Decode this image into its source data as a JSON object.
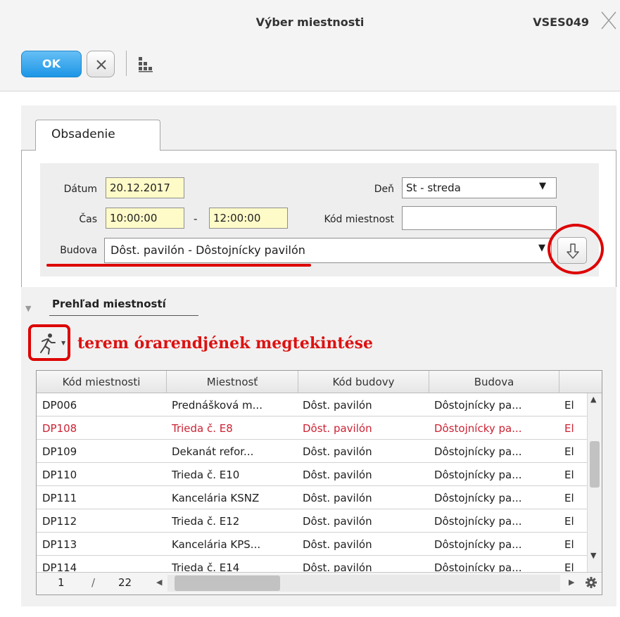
{
  "window": {
    "title": "Výber miestnosti",
    "code": "VSES049"
  },
  "toolbar": {
    "ok_label": "OK",
    "cancel_icon": "close-icon",
    "tree_icon": "hierarchy-icon"
  },
  "tab": {
    "label": "Obsadenie"
  },
  "form": {
    "datum_label": "Dátum",
    "datum_value": "20.12.2017",
    "den_label": "Deň",
    "den_value": "St - streda",
    "cas_label": "Čas",
    "cas_from": "10:00:00",
    "cas_dash": "-",
    "cas_to": "12:00:00",
    "kod_label": "Kód miestnost",
    "kod_value": "",
    "budova_label": "Budova",
    "budova_value": "Dôst. pavilón - Dôstojnícky pavilón"
  },
  "section": {
    "title": "Prehľad miestností"
  },
  "annotation": {
    "text": "terem órarendjének megtekintése",
    "color": "#dd1111"
  },
  "grid": {
    "columns": [
      "Kód miestnosti",
      "Miestnosť",
      "Kód budovy",
      "Budova"
    ],
    "rows": [
      {
        "kod": "DP006",
        "miestnost": "Prednášková m...",
        "kod_budovy": "Dôst. pavilón",
        "budova": "Dôstojnícky pa...",
        "extra": "El",
        "highlight": false
      },
      {
        "kod": "DP108",
        "miestnost": "Trieda č. E8",
        "kod_budovy": "Dôst. pavilón",
        "budova": "Dôstojnícky pa...",
        "extra": "El",
        "highlight": true
      },
      {
        "kod": "DP109",
        "miestnost": "Dekanát refor...",
        "kod_budovy": "Dôst. pavilón",
        "budova": "Dôstojnícky pa...",
        "extra": "El",
        "highlight": false
      },
      {
        "kod": "DP110",
        "miestnost": "Trieda č. E10",
        "kod_budovy": "Dôst. pavilón",
        "budova": "Dôstojnícky pa...",
        "extra": "El",
        "highlight": false
      },
      {
        "kod": "DP111",
        "miestnost": "Kancelária KSNZ",
        "kod_budovy": "Dôst. pavilón",
        "budova": "Dôstojnícky pa...",
        "extra": "El",
        "highlight": false
      },
      {
        "kod": "DP112",
        "miestnost": "Trieda č. E12",
        "kod_budovy": "Dôst. pavilón",
        "budova": "Dôstojnícky pa...",
        "extra": "El",
        "highlight": false
      },
      {
        "kod": "DP113",
        "miestnost": "Kancelária KPS...",
        "kod_budovy": "Dôst. pavilón",
        "budova": "Dôstojnícky pa...",
        "extra": "El",
        "highlight": false
      },
      {
        "kod": "DP114",
        "miestnost": "Trieda č. E14",
        "kod_budovy": "Dôst. pavilón",
        "budova": "Dôstojnícky pa...",
        "extra": "El",
        "highlight": false
      }
    ],
    "highlight_color": "#cc2233",
    "pager": {
      "current": "1",
      "separator": "/",
      "total": "22"
    }
  }
}
